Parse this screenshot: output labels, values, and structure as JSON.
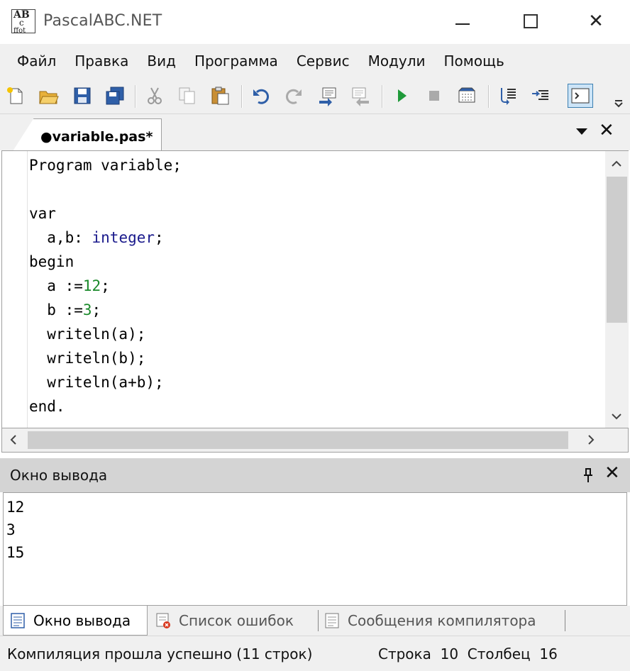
{
  "window": {
    "title": "PascalABC.NET",
    "icon_name": "pascalabc-app-icon",
    "icon_text": [
      "AB",
      "c",
      "ffot"
    ],
    "controls": [
      "minimize-icon",
      "maximize-icon",
      "close-icon"
    ],
    "close_glyph": "✕"
  },
  "menu": {
    "items": [
      "Файл",
      "Правка",
      "Вид",
      "Программа",
      "Сервис",
      "Модули",
      "Помощь"
    ]
  },
  "toolbar": {
    "buttons": [
      "new-file-icon",
      "open-folder-icon",
      "save-icon",
      "save-all-icon",
      "cut-icon",
      "copy-icon",
      "paste-icon",
      "undo-icon",
      "redo-icon",
      "compile-icon",
      "rebuild-icon",
      "run-icon",
      "stop-icon",
      "debug-icon",
      "step-into-icon",
      "step-over-icon",
      "console-icon"
    ]
  },
  "editor_tab": {
    "label": "●variable.pas*",
    "close_glyph": "✕"
  },
  "editor": {
    "lines": [
      [
        {
          "t": "Program variable;",
          "c": ""
        }
      ],
      [
        {
          "t": "",
          "c": ""
        }
      ],
      [
        {
          "t": "var",
          "c": ""
        }
      ],
      [
        {
          "t": "  a,b: ",
          "c": ""
        },
        {
          "t": "integer",
          "c": "ty"
        },
        {
          "t": ";",
          "c": ""
        }
      ],
      [
        {
          "t": "begin",
          "c": ""
        }
      ],
      [
        {
          "t": "  a :=",
          "c": ""
        },
        {
          "t": "12",
          "c": "num"
        },
        {
          "t": ";",
          "c": ""
        }
      ],
      [
        {
          "t": "  b :=",
          "c": ""
        },
        {
          "t": "3",
          "c": "num"
        },
        {
          "t": ";",
          "c": ""
        }
      ],
      [
        {
          "t": "  writeln(a);",
          "c": ""
        }
      ],
      [
        {
          "t": "  writeln(b);",
          "c": ""
        }
      ],
      [
        {
          "t": "  writeln(a+b);",
          "c": ""
        }
      ],
      [
        {
          "t": "end.",
          "c": ""
        }
      ]
    ]
  },
  "output": {
    "title": "Окно вывода",
    "close_glyph": "✕",
    "lines": [
      "12",
      "3",
      "15"
    ]
  },
  "bottom_tabs": [
    "Окно вывода",
    "Список ошибок",
    "Сообщения компилятора"
  ],
  "status": {
    "message": "Компиляция прошла успешно (11 строк)",
    "position": "Строка  10  Столбец  16"
  }
}
